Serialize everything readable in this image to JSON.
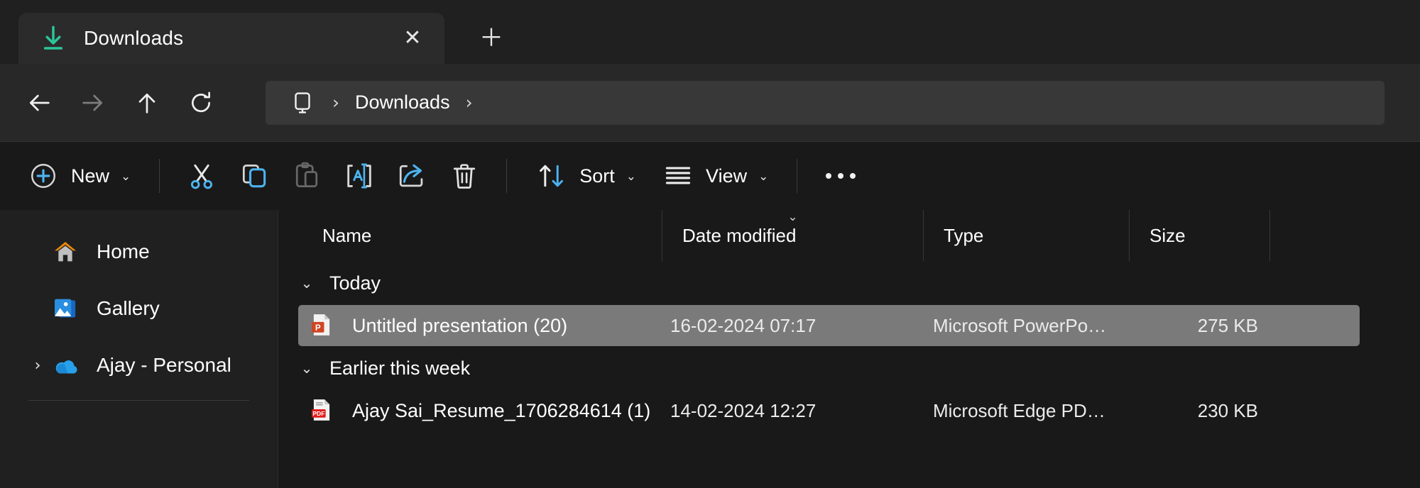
{
  "window": {
    "background": "#202020"
  },
  "tab": {
    "title": "Downloads",
    "icon": "download-icon",
    "icon_color": "#2cc49a",
    "close_glyph": "✕",
    "new_tab_glyph": "＋"
  },
  "nav": {
    "back": {
      "name": "back-button",
      "glyph": "←",
      "enabled": true
    },
    "forward": {
      "name": "forward-button",
      "glyph": "→",
      "enabled": false
    },
    "up": {
      "name": "up-button",
      "glyph": "↑",
      "enabled": true
    },
    "refresh": {
      "name": "refresh-button",
      "glyph": "↻",
      "enabled": true
    }
  },
  "address": {
    "root_icon": "this-pc-icon",
    "separator": "›",
    "crumbs": [
      "Downloads"
    ],
    "trailing_separator": "›"
  },
  "toolbar": {
    "new_label": "New",
    "chevron": "⌄",
    "cut_label": "Cut",
    "copy_label": "Copy",
    "paste_label": "Paste",
    "rename_label": "Rename",
    "share_label": "Share",
    "delete_label": "Delete",
    "sort_label": "Sort",
    "view_label": "View",
    "more_label": "See more",
    "accent": "#4cb3ef"
  },
  "sidebar": {
    "items": [
      {
        "label": "Home",
        "icon": "home-icon",
        "expandable": false
      },
      {
        "label": "Gallery",
        "icon": "gallery-icon",
        "expandable": false
      },
      {
        "label": "Ajay - Personal",
        "icon": "onedrive-icon",
        "expandable": true,
        "chevron": "›"
      }
    ]
  },
  "file_list": {
    "columns": [
      {
        "label": "Name",
        "sorted": false
      },
      {
        "label": "Date modified",
        "sorted": true,
        "sort_glyph": "⌄"
      },
      {
        "label": "Type",
        "sorted": false
      },
      {
        "label": "Size",
        "sorted": false
      }
    ],
    "groups": [
      {
        "label": "Today",
        "chevron": "⌄",
        "items": [
          {
            "name": "Untitled presentation (20)",
            "date": "16-02-2024 07:17",
            "type": "Microsoft PowerPo…",
            "size": "275 KB",
            "icon": "powerpoint-file-icon",
            "selected": true
          }
        ]
      },
      {
        "label": "Earlier this week",
        "chevron": "⌄",
        "items": [
          {
            "name": "Ajay Sai_Resume_1706284614 (1)",
            "date": "14-02-2024 12:27",
            "type": "Microsoft Edge PD…",
            "size": "230 KB",
            "icon": "pdf-file-icon",
            "selected": false
          }
        ]
      }
    ]
  }
}
